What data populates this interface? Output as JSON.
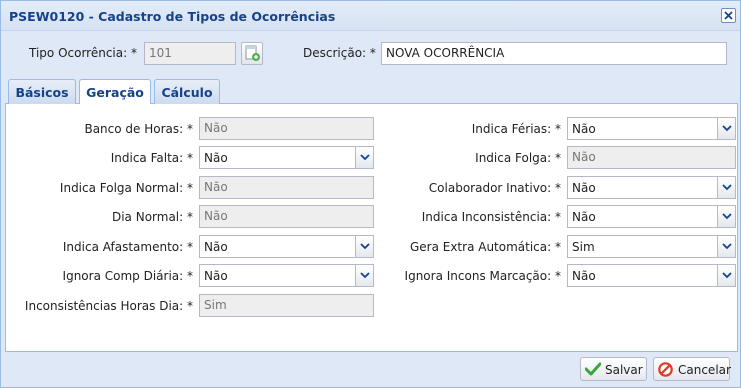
{
  "window": {
    "title": "PSEW0120 - Cadastro de Tipos de Ocorrências"
  },
  "header": {
    "tipo_label": "Tipo Ocorrência: *",
    "tipo_value": "101",
    "descricao_label": "Descrição: *",
    "descricao_value": "NOVA OCORRÊNCIA"
  },
  "tabs": [
    {
      "label": "Básicos"
    },
    {
      "label": "Geração"
    },
    {
      "label": "Cálculo"
    }
  ],
  "left_fields": [
    {
      "label": "Banco de Horas: *",
      "value": "Não",
      "kind": "readonly"
    },
    {
      "label": "Indica Falta: *",
      "value": "Não",
      "kind": "combo"
    },
    {
      "label": "Indica Folga Normal: *",
      "value": "Não",
      "kind": "readonly"
    },
    {
      "label": "Dia Normal: *",
      "value": "Não",
      "kind": "readonly"
    },
    {
      "label": "Indica Afastamento: *",
      "value": "Não",
      "kind": "combo"
    },
    {
      "label": "Ignora Comp Diária: *",
      "value": "Não",
      "kind": "combo"
    },
    {
      "label": "Inconsistências Horas Dia: *",
      "value": "Sim",
      "kind": "readonly"
    }
  ],
  "right_fields": [
    {
      "label": "Indica Férias: *",
      "value": "Não",
      "kind": "combo"
    },
    {
      "label": "Indica Folga: *",
      "value": "Não",
      "kind": "readonly"
    },
    {
      "label": "Colaborador Inativo: *",
      "value": "Não",
      "kind": "combo"
    },
    {
      "label": "Indica Inconsistência: *",
      "value": "Não",
      "kind": "combo"
    },
    {
      "label": "Gera Extra Automática: *",
      "value": "Sim",
      "kind": "combo"
    },
    {
      "label": "Ignora Incons Marcação: *",
      "value": "Não",
      "kind": "combo"
    }
  ],
  "footer": {
    "save_label": "Salvar",
    "cancel_label": "Cancelar"
  },
  "colors": {
    "title": "#15428b",
    "border": "#99bbe8",
    "body": "#dfe8f6"
  }
}
